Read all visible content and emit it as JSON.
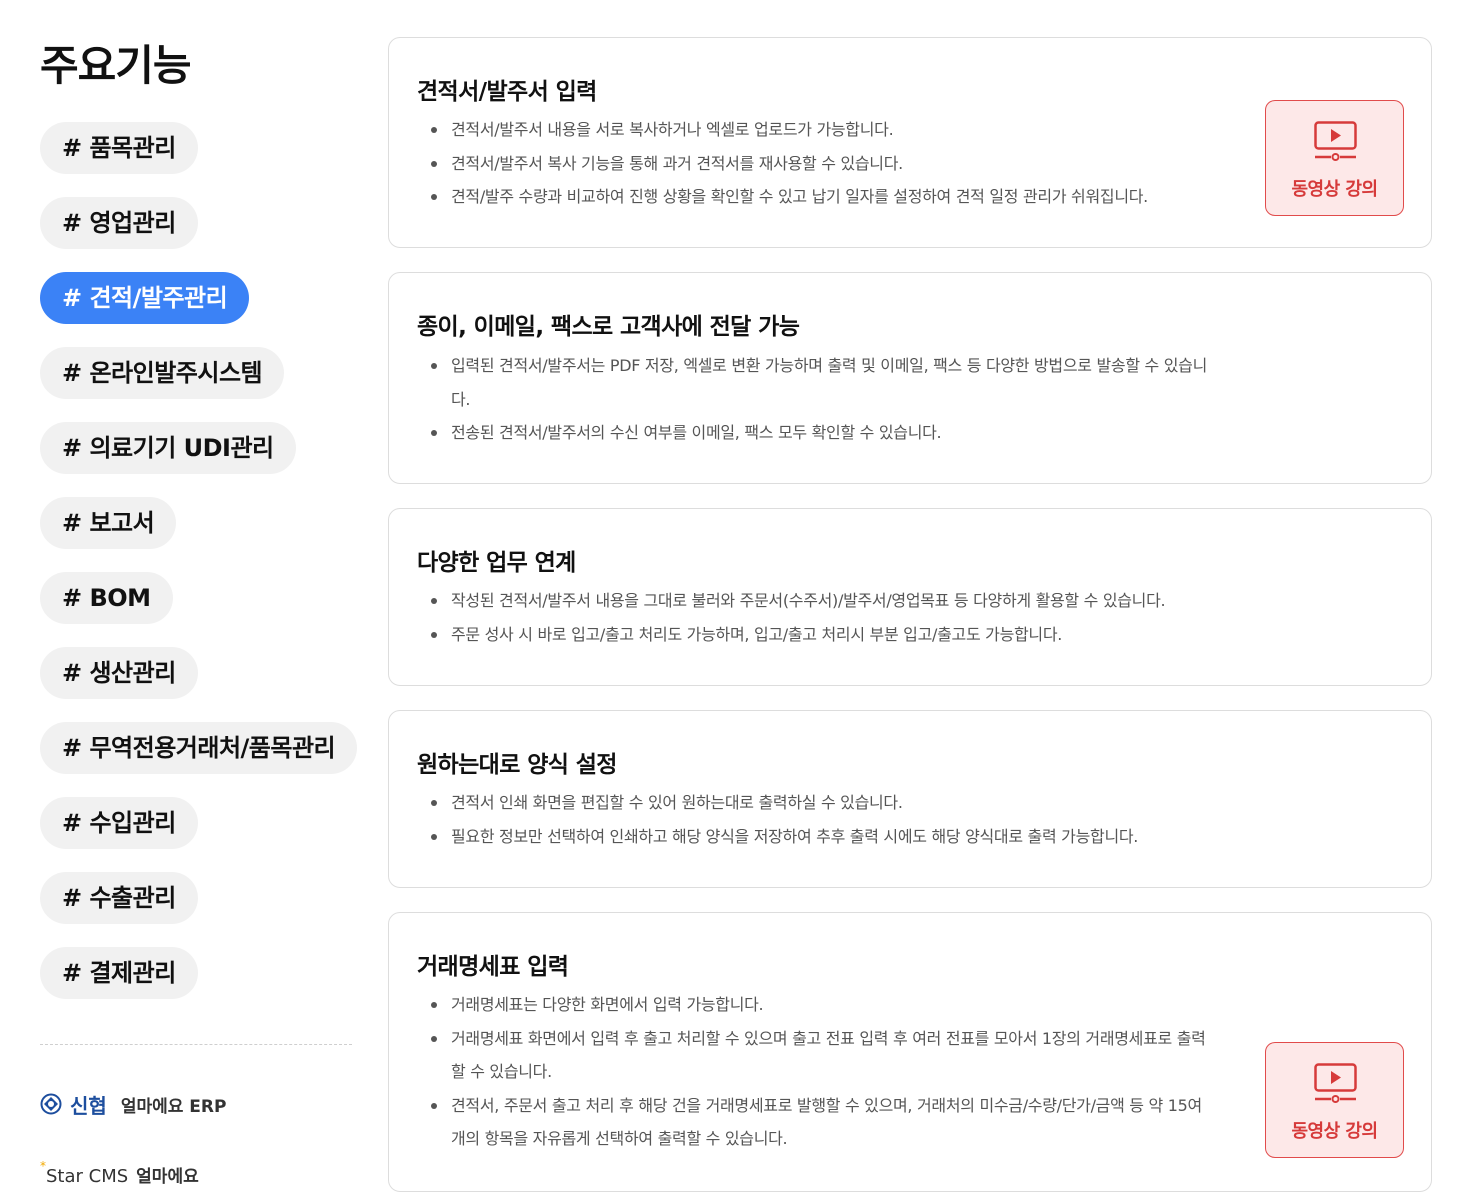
{
  "sidebar": {
    "title": "주요기능",
    "tags": [
      {
        "label": "# 품목관리",
        "active": false
      },
      {
        "label": "# 영업관리",
        "active": false
      },
      {
        "label": "# 견적/발주관리",
        "active": true
      },
      {
        "label": "# 온라인발주시스템",
        "active": false
      },
      {
        "label": "# 의료기기 UDI관리",
        "active": false
      },
      {
        "label": "# 보고서",
        "active": false
      },
      {
        "label": "# BOM",
        "active": false
      },
      {
        "label": "# 생산관리",
        "active": false
      },
      {
        "label": "# 무역전용거래처/품목관리",
        "active": false
      },
      {
        "label": "# 수입관리",
        "active": false
      },
      {
        "label": "# 수출관리",
        "active": false
      },
      {
        "label": "# 결제관리",
        "active": false
      }
    ],
    "brands": {
      "shinhyup_name": "신협",
      "shinhyup_sub": "얼마에요 ERP",
      "star_mark": "*",
      "star_name": "Star CMS",
      "star_sub": "얼마에요"
    }
  },
  "cards": [
    {
      "title": "견적서/발주서 입력",
      "items": [
        "견적서/발주서 내용을 서로 복사하거나 엑셀로 업로드가 가능합니다.",
        "견적서/발주서 복사 기능을 통해 과거 견적서를 재사용할 수 있습니다.",
        "견적/발주 수량과 비교하여 진행 상황을 확인할 수 있고 납기 일자를 설정하여 견적 일정 관리가 쉬워집니다."
      ],
      "video_label": "동영상 강의"
    },
    {
      "title": "종이, 이메일, 팩스로 고객사에 전달 가능",
      "items": [
        "입력된 견적서/발주서는 PDF 저장, 엑셀로 변환 가능하며 출력 및 이메일, 팩스 등 다양한 방법으로 발송할 수 있습니다.",
        "전송된 견적서/발주서의 수신 여부를 이메일, 팩스 모두 확인할 수 있습니다."
      ]
    },
    {
      "title": "다양한 업무 연계",
      "items": [
        "작성된 견적서/발주서 내용을 그대로 불러와 주문서(수주서)/발주서/영업목표 등 다양하게 활용할 수 있습니다.",
        "주문 성사 시 바로 입고/출고 처리도 가능하며, 입고/출고 처리시 부분 입고/출고도 가능합니다."
      ]
    },
    {
      "title": "원하는대로 양식 설정",
      "items": [
        "견적서 인쇄 화면을 편집할 수 있어 원하는대로 출력하실 수 있습니다.",
        "필요한 정보만 선택하여 인쇄하고 해당 양식을 저장하여 추후 출력 시에도 해당 양식대로 출력 가능합니다."
      ]
    },
    {
      "title": "거래명세표 입력",
      "items": [
        "거래명세표는 다양한 화면에서 입력 가능합니다.",
        "거래명세표 화면에서 입력 후 출고 처리할 수 있으며 출고 전표 입력 후 여러 전표를 모아서 1장의 거래명세표로 출력할 수 있습니다.",
        "견적서, 주문서 출고 처리 후 해당 건을 거래명세표로 발행할 수 있으며, 거래처의 미수금/수량/단가/금액 등 약 15여 개의 항목을 자유롭게 선택하여 출력할 수 있습니다."
      ],
      "video_label": "동영상 강의"
    }
  ],
  "colors": {
    "accent": "#3b82f6",
    "tag_bg": "#f1f1f1",
    "video_bg": "#fde8e8",
    "video_accent": "#d63a3a"
  },
  "icons": {
    "video": "video-play-icon",
    "brand": "shinhyup-logo-icon"
  }
}
